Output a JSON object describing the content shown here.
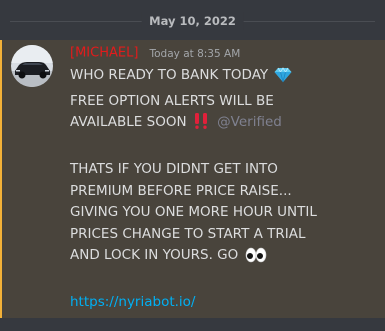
{
  "divider": {
    "date": "May 10, 2022"
  },
  "message": {
    "author": "[MICHAEL]",
    "timestamp": "Today at 8:35 AM",
    "lines": {
      "l1": "WHO READY TO BANK TODAY",
      "l2": "FREE OPTION ALERTS WILL BE",
      "l3": "AVAILABLE SOON",
      "mention": "@Verified",
      "l4": "THATS IF YOU DIDNT GET INTO",
      "l5": "PREMIUM BEFORE PRICE RAISE...",
      "l6": "GIVING YOU ONE MORE HOUR UNTIL",
      "l7": "PRICES CHANGE TO START A TRIAL",
      "l8": "AND LOCK IN YOURS. GO"
    },
    "link": "https://nyriabot.io/",
    "emojis": [
      "gem-icon",
      "double-exclamation-icon",
      "eyes-icon"
    ]
  },
  "colors": {
    "background": "#36393f",
    "highlight": "#49443c",
    "mention_bar": "#f3b138",
    "author": "#e31b1b",
    "link": "#00b0f4"
  }
}
